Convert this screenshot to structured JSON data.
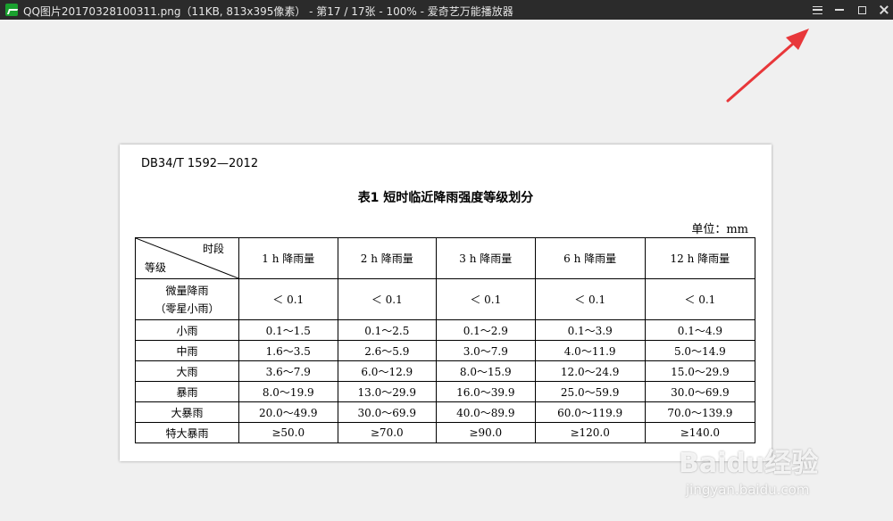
{
  "window": {
    "title": "QQ图片20170328100311.png（11KB, 813x395像素） - 第17 / 17张 - 100% - 爱奇艺万能播放器"
  },
  "document": {
    "std_code": "DB34/T 1592—2012",
    "table_title": "表1   短时临近降雨强度等级划分",
    "unit": "单位：mm",
    "header": {
      "corner_top": "时段",
      "corner_bottom": "等级",
      "columns": [
        "1 h 降雨量",
        "2 h 降雨量",
        "3 h 降雨量",
        "6 h 降雨量",
        "12 h 降雨量"
      ]
    },
    "rows": [
      {
        "level": "微量降雨",
        "level_sub": "（零星小雨）",
        "values": [
          "＜ 0.1",
          "＜ 0.1",
          "＜ 0.1",
          "＜ 0.1",
          "＜ 0.1"
        ]
      },
      {
        "level": "小雨",
        "values": [
          "0.1～1.5",
          "0.1～2.5",
          "0.1～2.9",
          "0.1～3.9",
          "0.1～4.9"
        ]
      },
      {
        "level": "中雨",
        "values": [
          "1.6～3.5",
          "2.6～5.9",
          "3.0～7.9",
          "4.0～11.9",
          "5.0～14.9"
        ]
      },
      {
        "level": "大雨",
        "values": [
          "3.6～7.9",
          "6.0～12.9",
          "8.0～15.9",
          "12.0～24.9",
          "15.0～29.9"
        ]
      },
      {
        "level": "暴雨",
        "values": [
          "8.0～19.9",
          "13.0～29.9",
          "16.0～39.9",
          "25.0～59.9",
          "30.0～69.9"
        ]
      },
      {
        "level": "大暴雨",
        "values": [
          "20.0～49.9",
          "30.0～69.9",
          "40.0～89.9",
          "60.0～119.9",
          "70.0～139.9"
        ]
      },
      {
        "level": "特大暴雨",
        "values": [
          "≥50.0",
          "≥70.0",
          "≥90.0",
          "≥120.0",
          "≥140.0"
        ]
      }
    ]
  },
  "watermark": {
    "brand": "Baidu经验",
    "url": "jingyan.baidu.com"
  },
  "colors": {
    "titlebar": "#2b2b2b",
    "background": "#f0f0f0",
    "arrow": "#e8373a"
  },
  "icons": {
    "app": "player-app-icon",
    "menu": "hamburger-menu-icon",
    "minimize": "minimize-icon",
    "maximize": "maximize-icon",
    "close": "close-icon"
  }
}
